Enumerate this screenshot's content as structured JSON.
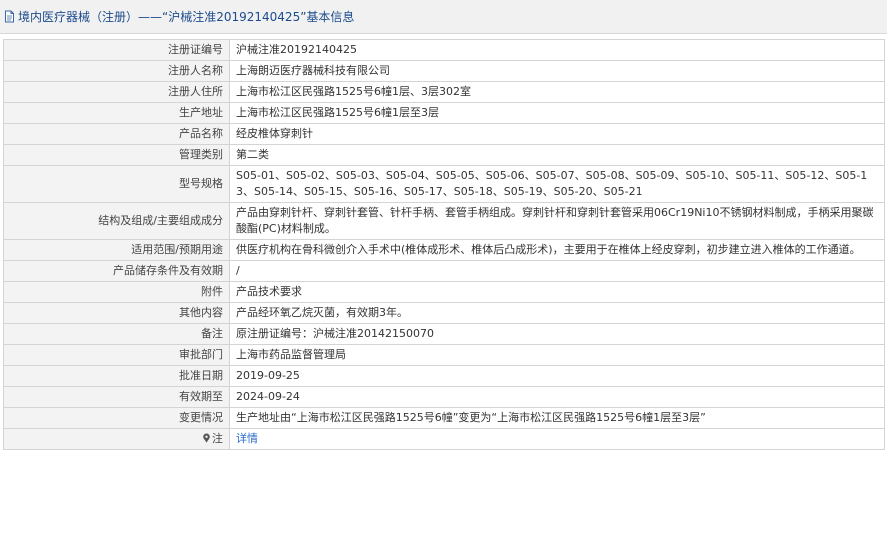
{
  "header": {
    "title": "境内医疗器械（注册）——“沪械注准20192140425”基本信息"
  },
  "rows": [
    {
      "label": "注册证编号",
      "value": "沪械注准20192140425"
    },
    {
      "label": "注册人名称",
      "value": "上海朗迈医疗器械科技有限公司"
    },
    {
      "label": "注册人住所",
      "value": "上海市松江区民强路1525号6幢1层、3层302室"
    },
    {
      "label": "生产地址",
      "value": "上海市松江区民强路1525号6幢1层至3层"
    },
    {
      "label": "产品名称",
      "value": "经皮椎体穿刺针"
    },
    {
      "label": "管理类别",
      "value": "第二类"
    },
    {
      "label": "型号规格",
      "value": "S05-01、S05-02、S05-03、S05-04、S05-05、S05-06、S05-07、S05-08、S05-09、S05-10、S05-11、S05-12、S05-13、S05-14、S05-15、S05-16、S05-17、S05-18、S05-19、S05-20、S05-21"
    },
    {
      "label": "结构及组成/主要组成成分",
      "value": "产品由穿刺针杆、穿刺针套管、针杆手柄、套管手柄组成。穿刺针杆和穿刺针套管采用06Cr19Ni10不锈钢材料制成，手柄采用聚碳酸酯(PC)材料制成。"
    },
    {
      "label": "适用范围/预期用途",
      "value": "供医疗机构在骨科微创介入手术中(椎体成形术、椎体后凸成形术)，主要用于在椎体上经皮穿刺，初步建立进入椎体的工作通道。"
    },
    {
      "label": "产品储存条件及有效期",
      "value": "/"
    },
    {
      "label": "附件",
      "value": "产品技术要求"
    },
    {
      "label": "其他内容",
      "value": "产品经环氧乙烷灭菌，有效期3年。"
    },
    {
      "label": "备注",
      "value": "原注册证编号：沪械注准20142150070"
    },
    {
      "label": "审批部门",
      "value": "上海市药品监督管理局"
    },
    {
      "label": "批准日期",
      "value": "2019-09-25"
    },
    {
      "label": "有效期至",
      "value": "2024-09-24"
    },
    {
      "label": "变更情况",
      "value": "生产地址由“上海市松江区民强路1525号6幢”变更为“上海市松江区民强路1525号6幢1层至3层”"
    }
  ],
  "note": {
    "label": "注",
    "link": "详情",
    "icon": "map-pin-icon"
  }
}
